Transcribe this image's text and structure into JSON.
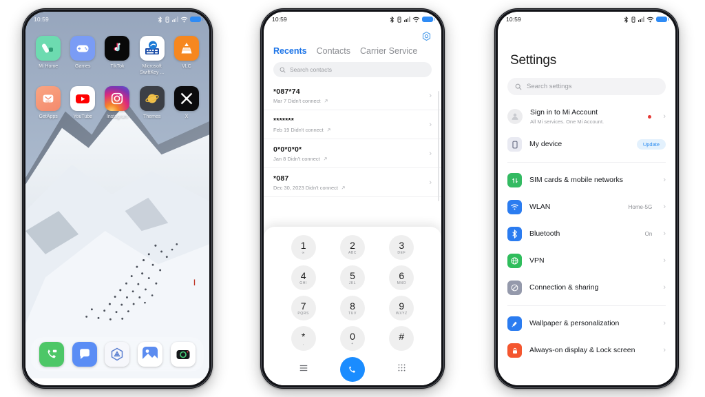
{
  "status_bar": {
    "time": "10:59",
    "icons": [
      "bluetooth-icon",
      "vibrate-icon",
      "signal-bars-icon",
      "wifi-icon",
      "battery-icon"
    ]
  },
  "home_screen": {
    "apps_row1": [
      {
        "label": "Mi Home",
        "icon": "mi-home-icon"
      },
      {
        "label": "Games",
        "icon": "games-icon"
      },
      {
        "label": "TikTok",
        "icon": "tiktok-icon"
      },
      {
        "label": "Microsoft SwiftKey ...",
        "icon": "swiftkey-icon"
      },
      {
        "label": "VLC",
        "icon": "vlc-icon"
      }
    ],
    "apps_row2": [
      {
        "label": "GetApps",
        "icon": "getapps-icon"
      },
      {
        "label": "YouTube",
        "icon": "youtube-icon"
      },
      {
        "label": "Instagram",
        "icon": "instagram-icon"
      },
      {
        "label": "Themes",
        "icon": "themes-icon"
      },
      {
        "label": "X",
        "icon": "x-icon"
      }
    ],
    "dock": [
      {
        "label": "Phone",
        "icon": "phone-icon"
      },
      {
        "label": "Messages",
        "icon": "messages-icon"
      },
      {
        "label": "Security",
        "icon": "security-icon"
      },
      {
        "label": "Gallery",
        "icon": "gallery-icon"
      },
      {
        "label": "Camera",
        "icon": "camera-icon"
      }
    ]
  },
  "dialer": {
    "settings_icon": "dialer-settings-icon",
    "tabs": [
      {
        "label": "Recents",
        "active": true
      },
      {
        "label": "Contacts",
        "active": false
      },
      {
        "label": "Carrier Service",
        "active": false
      }
    ],
    "search_placeholder": "Search contacts",
    "calls": [
      {
        "number": "*087*74",
        "detail": "Mar 7 Didn't connect"
      },
      {
        "number": "*******",
        "detail": "Feb 19 Didn't connect"
      },
      {
        "number": "0*0*0*0*",
        "detail": "Jan 8 Didn't connect"
      },
      {
        "number": "*087",
        "detail": "Dec 30, 2023 Didn't connect"
      }
    ],
    "keys": [
      {
        "digit": "1",
        "sub": "∞"
      },
      {
        "digit": "2",
        "sub": "ABC"
      },
      {
        "digit": "3",
        "sub": "DEF"
      },
      {
        "digit": "4",
        "sub": "GHI"
      },
      {
        "digit": "5",
        "sub": "JKL"
      },
      {
        "digit": "6",
        "sub": "MNO"
      },
      {
        "digit": "7",
        "sub": "PQRS"
      },
      {
        "digit": "8",
        "sub": "TUV"
      },
      {
        "digit": "9",
        "sub": "WXYZ"
      },
      {
        "digit": "*",
        "sub": ","
      },
      {
        "digit": "0",
        "sub": "+"
      },
      {
        "digit": "#",
        "sub": ""
      }
    ],
    "actions": {
      "menu_icon": "menu-icon",
      "call_icon": "call-icon",
      "keypad_icon": "keypad-icon"
    },
    "accent": "#1a8cff"
  },
  "settings": {
    "title": "Settings",
    "search_placeholder": "Search settings",
    "account": {
      "label": "Sign in to Mi Account",
      "sub": "All Mi services. One Mi Account.",
      "icon": "account-avatar-icon",
      "has_dot": true
    },
    "device": {
      "label": "My device",
      "badge": "Update",
      "icon": "my-device-icon"
    },
    "group_network": [
      {
        "label": "SIM cards & mobile networks",
        "value": "",
        "icon": "sim-icon",
        "color": "#33ba62"
      },
      {
        "label": "WLAN",
        "value": "Home-5G",
        "icon": "wifi-icon",
        "color": "#2b7cf0"
      },
      {
        "label": "Bluetooth",
        "value": "On",
        "icon": "bluetooth-icon",
        "color": "#2b7cf0"
      },
      {
        "label": "VPN",
        "value": "",
        "icon": "vpn-globe-icon",
        "color": "#2fbd5c"
      },
      {
        "label": "Connection & sharing",
        "value": "",
        "icon": "connection-sharing-icon",
        "color": "#8b8fa3"
      }
    ],
    "group_personalization": [
      {
        "label": "Wallpaper & personalization",
        "value": "",
        "icon": "wallpaper-icon",
        "color": "#2b7cf0"
      },
      {
        "label": "Always-on display & Lock screen",
        "value": "",
        "icon": "lock-icon",
        "color": "#f4562f"
      }
    ]
  }
}
